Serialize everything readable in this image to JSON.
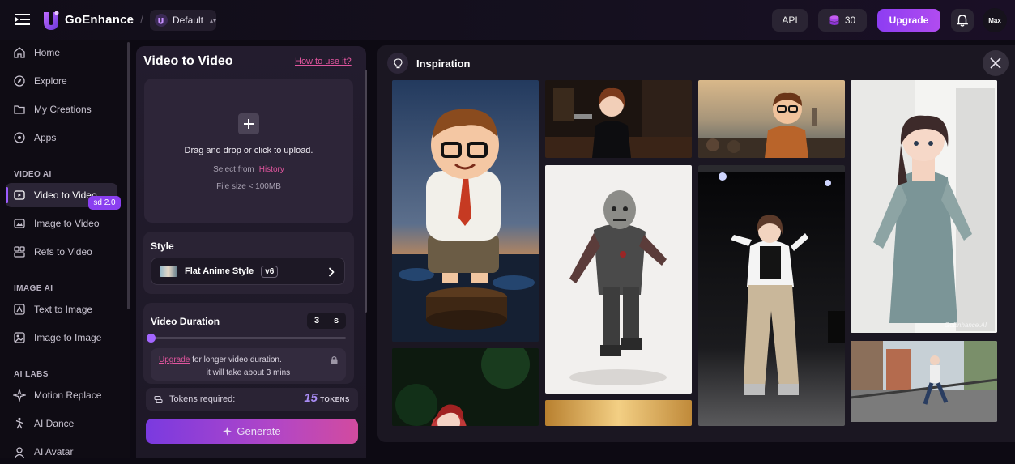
{
  "topbar": {
    "brand": "GoEnhance",
    "workspace": "Default",
    "api_label": "API",
    "credits": "30",
    "upgrade_label": "Upgrade",
    "avatar_text": "Max"
  },
  "sidebar": {
    "items_main": [
      {
        "label": "Home",
        "icon": "home-icon"
      },
      {
        "label": "Explore",
        "icon": "compass-icon"
      },
      {
        "label": "My Creations",
        "icon": "folder-icon"
      },
      {
        "label": "Apps",
        "icon": "apps-icon"
      }
    ],
    "section_video": "VIDEO AI",
    "items_video": [
      {
        "label": "Video to Video",
        "icon": "video-icon",
        "active": true
      },
      {
        "label": "Image to Video",
        "icon": "image-video-icon"
      },
      {
        "label": "Refs to Video",
        "icon": "refs-icon"
      }
    ],
    "badge_sd": "sd 2.0",
    "section_image": "IMAGE AI",
    "items_image": [
      {
        "label": "Text to Image",
        "icon": "text-image-icon"
      },
      {
        "label": "Image to Image",
        "icon": "image-image-icon"
      }
    ],
    "section_labs": "AI LABS",
    "items_labs": [
      {
        "label": "Motion Replace",
        "icon": "sparkle-icon"
      },
      {
        "label": "AI Dance",
        "icon": "dance-icon"
      },
      {
        "label": "AI Avatar",
        "icon": "avatar-icon"
      }
    ]
  },
  "panel": {
    "title": "Video to Video",
    "how_to": "How to use it?",
    "upload_main": "Drag and drop or click to upload.",
    "upload_select": "Select from",
    "upload_history": "History",
    "upload_size": "File size < 100MB",
    "style_label": "Style",
    "style_name": "Flat Anime Style",
    "style_version": "v6",
    "duration_label": "Video Duration",
    "duration_value": "3",
    "duration_unit": "s",
    "duration_fraction": 0.0,
    "note_link": "Upgrade",
    "note_rest": " for longer video duration.",
    "note_line2": "it will take about 3 mins",
    "tokens_label": "Tokens required:",
    "tokens_value": "15",
    "tokens_unit": "TOKENS",
    "generate_label": "Generate"
  },
  "inspiration": {
    "title": "Inspiration",
    "watermark": "GoEnhance.AI"
  },
  "colors": {
    "accent": "#9c5cff",
    "link": "#e1559e",
    "upgrade": "#a046f2"
  }
}
